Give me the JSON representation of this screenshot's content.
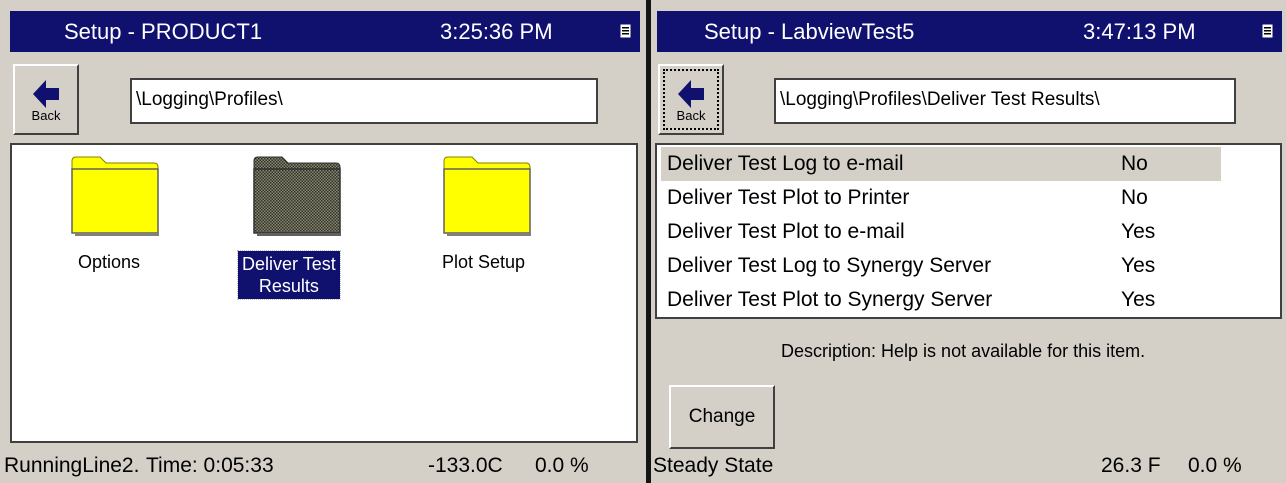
{
  "left_window": {
    "title": "Setup - PRODUCT1",
    "time": "3:25:36 PM",
    "title_icon": "window-menu-icon",
    "back_label": "Back",
    "path": "\\Logging\\Profiles\\",
    "folders": [
      {
        "label": "Options",
        "selected": false
      },
      {
        "label": "Deliver Test Results",
        "label_line1": "Deliver Test",
        "label_line2": "Results",
        "selected": true
      },
      {
        "label": "Plot Setup",
        "selected": false
      }
    ],
    "status": {
      "line": "RunningLine2.",
      "time": "Time: 0:05:33",
      "temperature": "-133.0C",
      "percent": "0.0 %"
    }
  },
  "right_window": {
    "title": "Setup - LabviewTest5",
    "time": "3:47:13 PM",
    "title_icon": "window-menu-icon",
    "back_label": "Back",
    "path": "\\Logging\\Profiles\\Deliver Test Results\\",
    "settings": [
      {
        "label": "Deliver Test Log to e-mail",
        "value": "No",
        "selected": true
      },
      {
        "label": "Deliver Test Plot to Printer",
        "value": "No",
        "selected": false
      },
      {
        "label": "Deliver Test Plot to e-mail",
        "value": "Yes",
        "selected": false
      },
      {
        "label": "Deliver Test Log to Synergy Server",
        "value": "Yes",
        "selected": false
      },
      {
        "label": "Deliver Test Plot to Synergy Server",
        "value": "Yes",
        "selected": false
      }
    ],
    "description": "Description:  Help is not available for this item.",
    "change_label": "Change",
    "status": {
      "state": "Steady State",
      "temperature": "26.3 F",
      "percent": "0.0 %"
    }
  },
  "colors": {
    "titlebar": "#10106e",
    "panel": "#d4d0c8",
    "folder": "#ffff00",
    "selection": "#10106e"
  }
}
